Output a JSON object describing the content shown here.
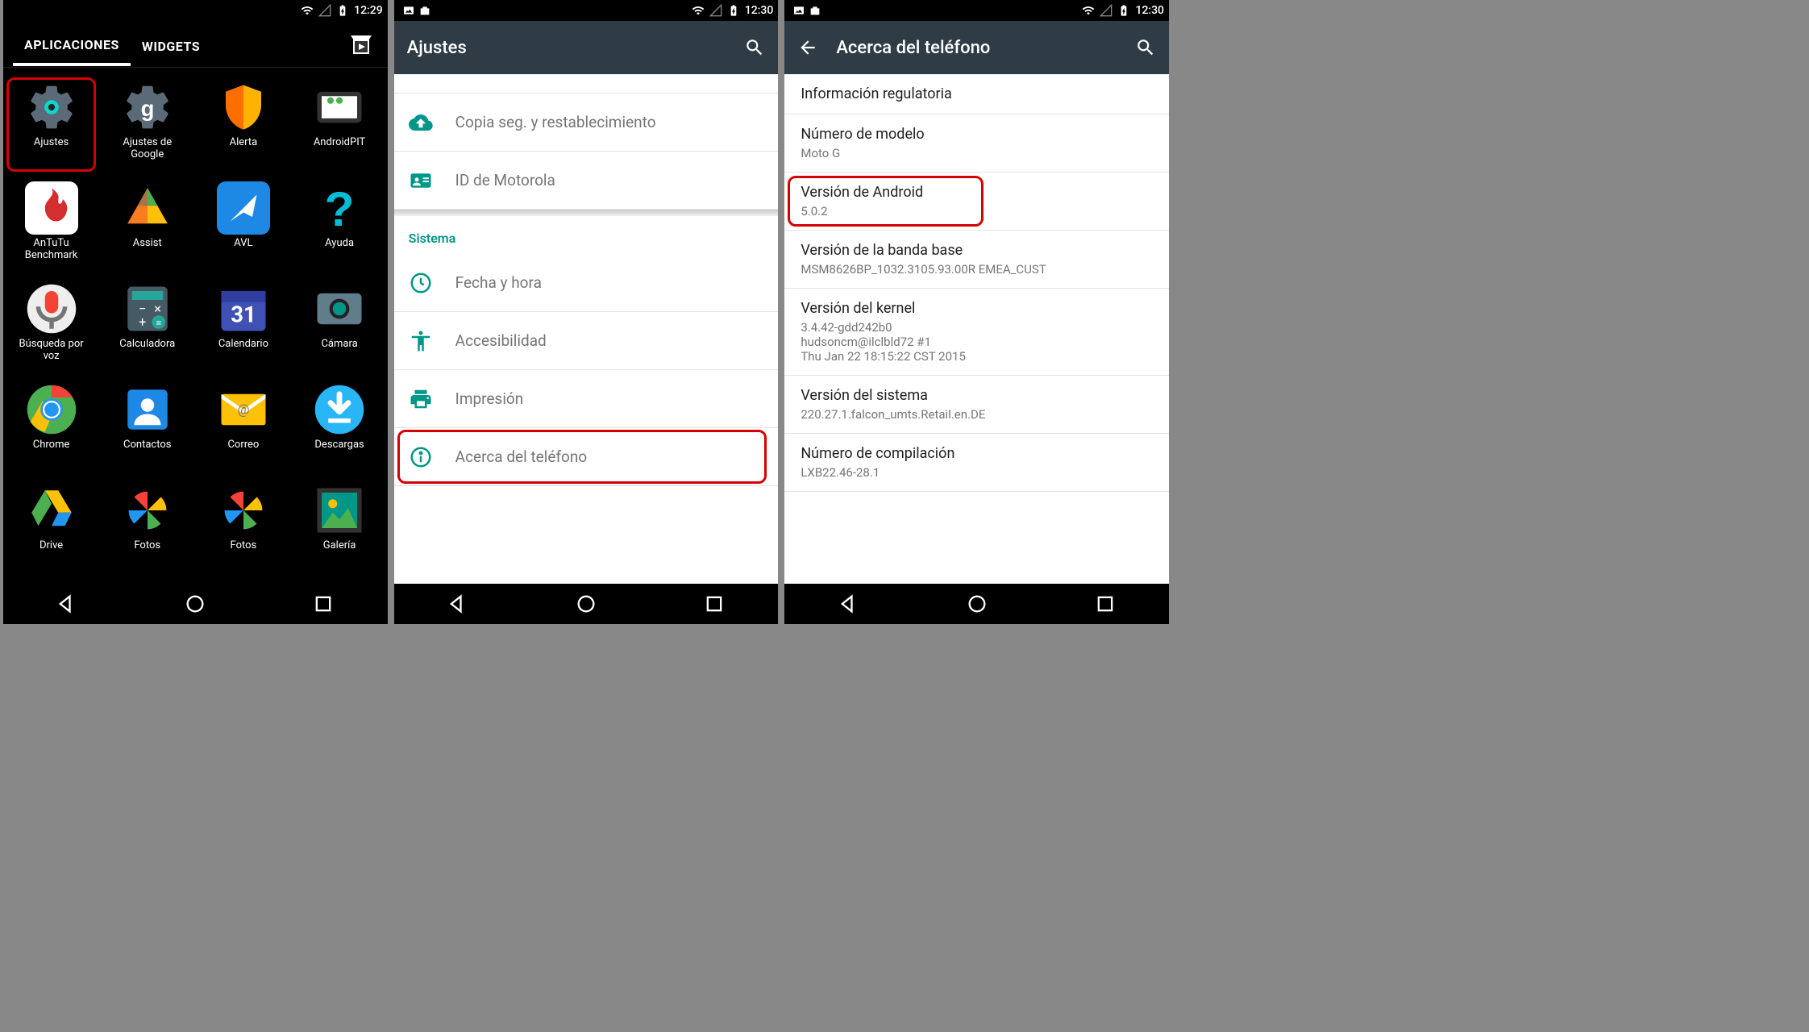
{
  "phone1": {
    "statusbar_time": "12:29",
    "tabs": {
      "apps": "APLICACIONES",
      "widgets": "WIDGETS"
    },
    "highlighted": "ajustes",
    "apps": [
      {
        "id": "ajustes",
        "label": "Ajustes",
        "icon": "gear"
      },
      {
        "id": "ajustes-google",
        "label": "Ajustes de\nGoogle",
        "icon": "gear-g"
      },
      {
        "id": "alerta",
        "label": "Alerta",
        "icon": "shield-orange"
      },
      {
        "id": "androidpit",
        "label": "AndroidPIT",
        "icon": "androidpit"
      },
      {
        "id": "antutu",
        "label": "AnTuTu\nBenchmark",
        "icon": "flame"
      },
      {
        "id": "assist",
        "label": "Assist",
        "icon": "triangle-colors"
      },
      {
        "id": "avl",
        "label": "AVL",
        "icon": "avl"
      },
      {
        "id": "ayuda",
        "label": "Ayuda",
        "icon": "question"
      },
      {
        "id": "busqueda-voz",
        "label": "Búsqueda por\nvoz",
        "icon": "mic"
      },
      {
        "id": "calculadora",
        "label": "Calculadora",
        "icon": "calculator"
      },
      {
        "id": "calendario",
        "label": "Calendario",
        "icon": "calendar"
      },
      {
        "id": "camara",
        "label": "Cámara",
        "icon": "camera-circle"
      },
      {
        "id": "chrome",
        "label": "Chrome",
        "icon": "chrome"
      },
      {
        "id": "contactos",
        "label": "Contactos",
        "icon": "contacts"
      },
      {
        "id": "correo",
        "label": "Correo",
        "icon": "mail"
      },
      {
        "id": "descargas",
        "label": "Descargas",
        "icon": "download"
      },
      {
        "id": "drive",
        "label": "Drive",
        "icon": "drive"
      },
      {
        "id": "fotos1",
        "label": "Fotos",
        "icon": "photos"
      },
      {
        "id": "fotos2",
        "label": "Fotos",
        "icon": "photos"
      },
      {
        "id": "galeria",
        "label": "Galería",
        "icon": "gallery"
      }
    ]
  },
  "phone2": {
    "statusbar_time": "12:30",
    "title": "Ajustes",
    "rows": [
      {
        "id": "copia",
        "label": "Copia seg. y restablecimiento",
        "icon": "cloud-up"
      },
      {
        "id": "motoid",
        "label": "ID de Motorola",
        "icon": "id-card"
      }
    ],
    "section_header": "Sistema",
    "system_rows": [
      {
        "id": "fechahora",
        "label": "Fecha y hora",
        "icon": "clock"
      },
      {
        "id": "accesibilidad",
        "label": "Accesibilidad",
        "icon": "accessibility"
      },
      {
        "id": "impresion",
        "label": "Impresión",
        "icon": "print"
      },
      {
        "id": "acerca",
        "label": "Acerca del teléfono",
        "icon": "info",
        "highlighted": true
      }
    ]
  },
  "phone3": {
    "statusbar_time": "12:30",
    "title": "Acerca del teléfono",
    "rows": [
      {
        "id": "info-reg",
        "primary": "Información regulatoria"
      },
      {
        "id": "modelo",
        "primary": "Número de modelo",
        "secondary": "Moto G"
      },
      {
        "id": "android-ver",
        "primary": "Versión de Android",
        "secondary": "5.0.2",
        "highlighted": true
      },
      {
        "id": "banda-base",
        "primary": "Versión de la banda base",
        "secondary": "MSM8626BP_1032.3105.93.00R EMEA_CUST"
      },
      {
        "id": "kernel",
        "primary": "Versión del kernel",
        "secondary": "3.4.42-gdd242b0\nhudsoncm@ilclbld72 #1\nThu Jan 22 18:15:22 CST 2015"
      },
      {
        "id": "sistema",
        "primary": "Versión del sistema",
        "secondary": "220.27.1.falcon_umts.Retail.en.DE"
      },
      {
        "id": "compilacion",
        "primary": "Número de compilación",
        "secondary": "LXB22.46-28.1"
      }
    ]
  },
  "colors": {
    "teal": "#009688",
    "statusbar_bg": "#000"
  }
}
